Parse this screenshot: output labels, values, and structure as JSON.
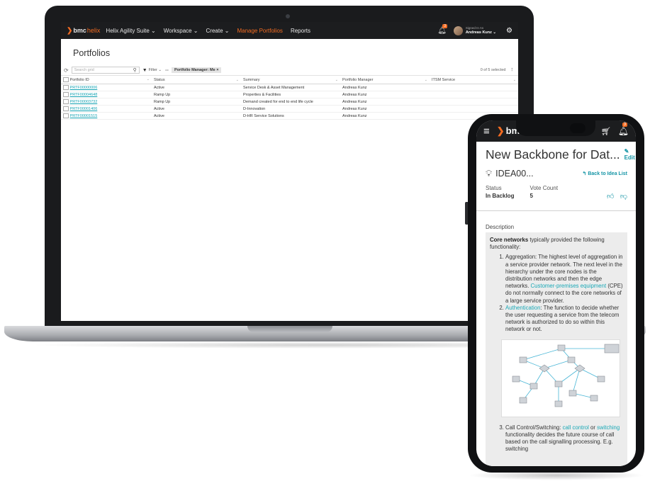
{
  "laptop": {
    "nav": {
      "logo_bmc": "bmc",
      "logo_helix": "helix",
      "items": [
        "Helix Agility Suite ⌄",
        "Workspace ⌄",
        "Create ⌄",
        "Manage Portfolios",
        "Reports"
      ],
      "notification_count": "3",
      "signed_in_as": "Signed In As",
      "user_name": "Andreas Kunz ⌄"
    },
    "page_title": "Portfolios",
    "toolbar": {
      "search_placeholder": "Search grid",
      "filter_label": "Filter ⌄",
      "chip_label": "Portfolio Manager: Me ×",
      "selected_count": "0 of 5 selected"
    },
    "grid": {
      "columns": [
        "Portfolio ID",
        "Status",
        "Summary",
        "Portfolio Manager",
        "ITSM Service"
      ],
      "rows": [
        {
          "id": "PRTF00000006",
          "status": "Active",
          "summary": "Service Desk & Asset Management",
          "manager": "Andreas Kunz",
          "service": ""
        },
        {
          "id": "PRTF00004648",
          "status": "Ramp Up",
          "summary": "Properties & Facilities",
          "manager": "Andreas Kunz",
          "service": ""
        },
        {
          "id": "PRTF00003732",
          "status": "Ramp Up",
          "summary": "Demand created for end to end life cycle",
          "manager": "Andreas Kunz",
          "service": ""
        },
        {
          "id": "PRTF00001406",
          "status": "Active",
          "summary": "D-Innovation",
          "manager": "Andreas Kunz",
          "service": ""
        },
        {
          "id": "PRTF00001515",
          "status": "Active",
          "summary": "D-HR Service Solutions",
          "manager": "Andreas Kunz",
          "service": ""
        }
      ]
    }
  },
  "phone": {
    "nav": {
      "logo": "bmc",
      "notification_count": "3"
    },
    "title": "New Backbone for Dat...",
    "edit_label": "Edit",
    "idea_id": "IDEA00...",
    "back_label": "Back to Idea List",
    "status_label": "Status",
    "status_value": "In Backlog",
    "vote_label": "Vote Count",
    "vote_value": "5",
    "description_label": "Description",
    "desc_intro_bold": "Core networks",
    "desc_intro_rest": " typically provided the following functionality:",
    "item1_text": "Aggregation: The highest level of aggregation in a service provider network. The next level in the hierarchy under the core nodes is the distribution networks and then the edge networks. ",
    "item1_link": "Customer-premises equipment",
    "item1_tail": " (CPE) do not normally connect to the core networks of a large service provider.",
    "item2_link": "Authentication",
    "item2_text": ": The function to decide whether the user requesting a service from the telecom network is authorized to do so within this network or not.",
    "item3_text": "Call Control/Switching: ",
    "item3_link1": "call control",
    "item3_mid": " or ",
    "item3_link2": "switching",
    "item3_tail": " functionality decides the future course of call based on the call signalling processing. E.g. switching"
  },
  "colors": {
    "accent": "#f26b21",
    "link": "#1595a6",
    "nav_bg": "#1c1d1f"
  }
}
